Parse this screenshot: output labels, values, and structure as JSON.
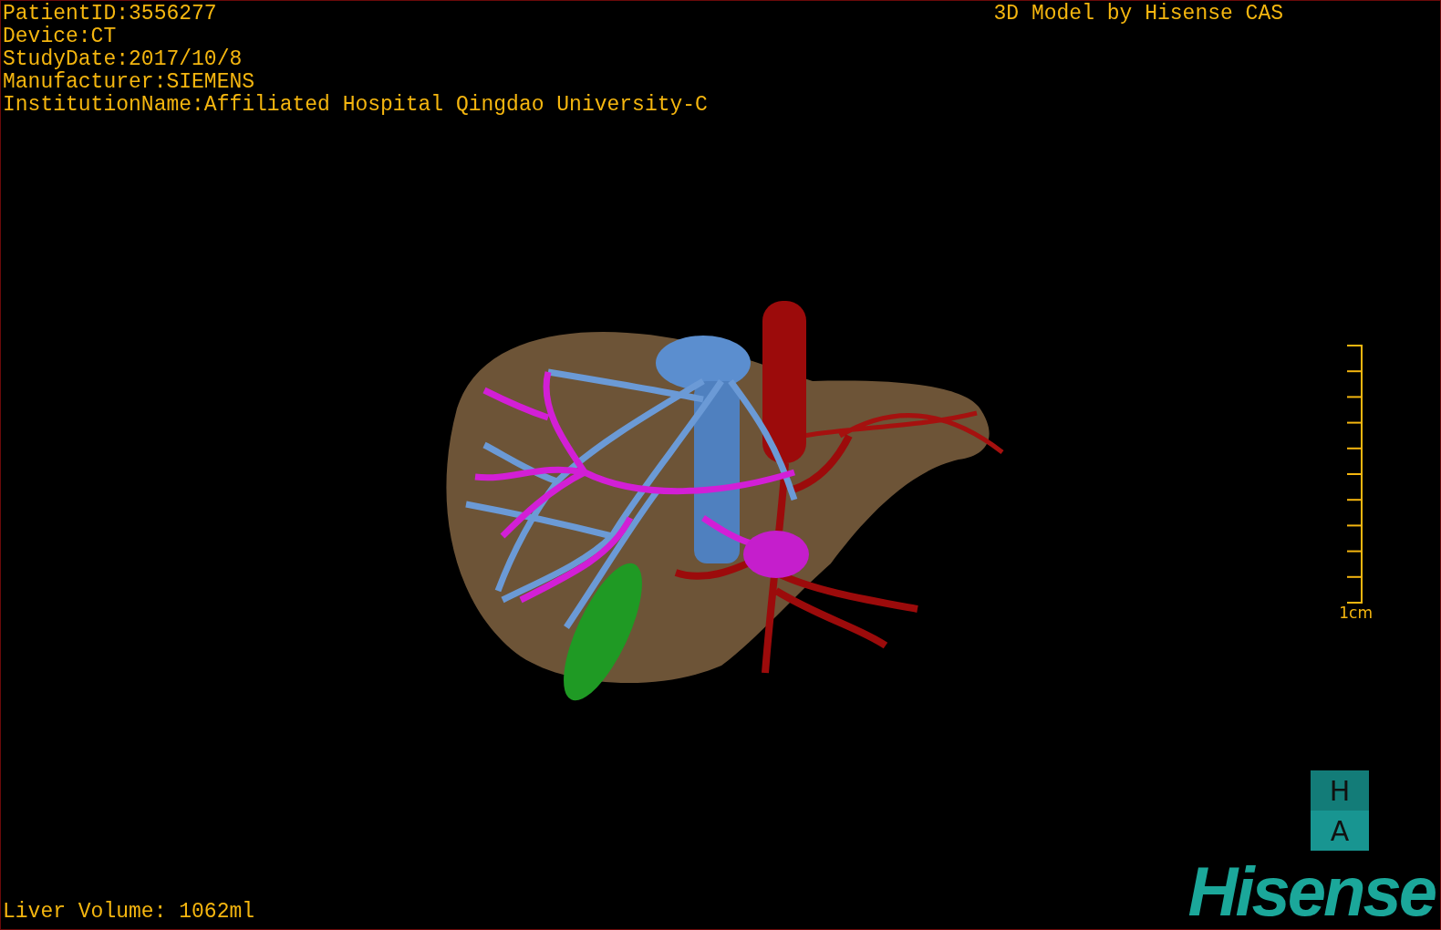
{
  "patient_info": [
    "PatientID:3556277",
    "Device:CT",
    "StudyDate:2017/10/8",
    "Manufacturer:SIEMENS",
    "InstitutionName:Affiliated Hospital Qingdao University-C"
  ],
  "title": "3D Model by Hisense CAS",
  "scale_bar": {
    "label": "1cm"
  },
  "orientation_cube": {
    "faces": [
      "H",
      "A"
    ]
  },
  "liver_volume": "Liver Volume: 1062ml",
  "logo": "Hisense"
}
